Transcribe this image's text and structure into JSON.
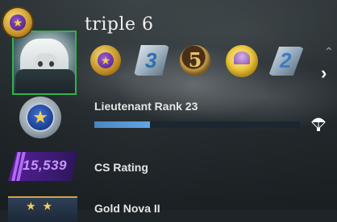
{
  "profile": {
    "username": "triple 6",
    "prime_badge_icon": "prime-star-icon"
  },
  "medals": [
    {
      "name": "prime-medal",
      "icon": "star-icon",
      "glyph": "★"
    },
    {
      "name": "service-medal-3",
      "glyph": "3"
    },
    {
      "name": "coin-5",
      "glyph": "5"
    },
    {
      "name": "operation-coin",
      "glyph": ""
    },
    {
      "name": "service-medal-2",
      "glyph": "2"
    }
  ],
  "nav": {
    "next_arrow": "›",
    "prev_arrow": "›"
  },
  "rank": {
    "label": "Lieutenant Rank 23",
    "icon": "star-icon",
    "glyph": "★",
    "xp_progress": 0.27,
    "drop_icon": "parachute-icon",
    "drop_glyph": "🪂"
  },
  "rating": {
    "value": "15,539",
    "label": "CS Rating"
  },
  "skill": {
    "label": "Gold Nova II",
    "stars": "★ ★"
  },
  "colors": {
    "rating_purple": "#c995ff",
    "xp_blue": "#62a6e6",
    "avatar_border": "#34b24a"
  }
}
